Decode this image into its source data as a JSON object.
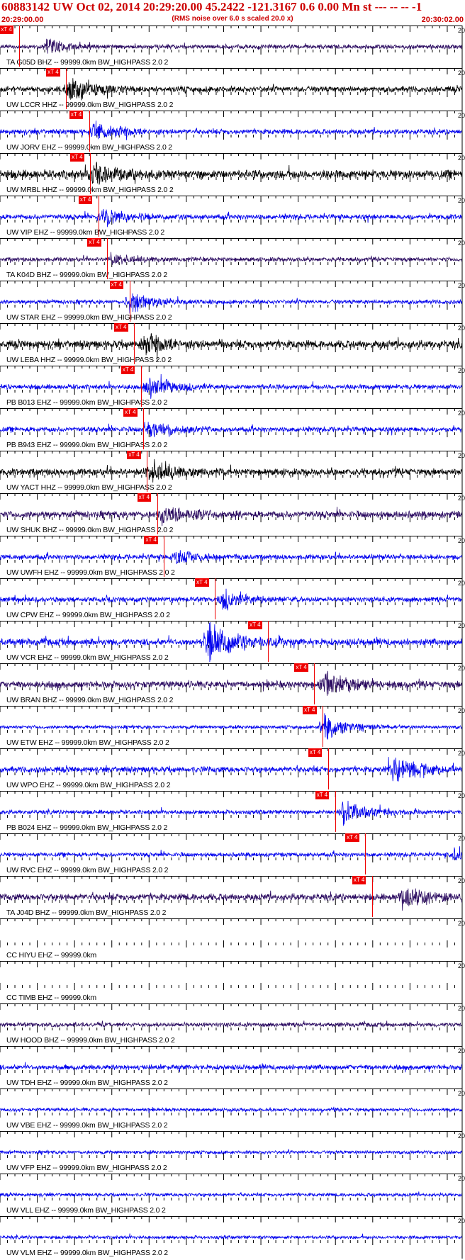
{
  "header": {
    "title": "60883142 UW Oct 02, 2014 20:29:20.00   45.2422 -121.3167  0.6 0.00 Mn st --- -- --  -1",
    "subtitle": "(RMS noise over 6.0 s scaled 20.0 x)",
    "time_start": "20:29:00.00",
    "time_end": "20:30:02.00"
  },
  "colors": {
    "blue_trace": "#0000ee",
    "black_trace": "#000000",
    "purple_trace": "#2a0a60",
    "pick": "#ee0000",
    "header_text": "#cc0000"
  },
  "pick_label": "xT 4",
  "edge_label": "20",
  "stations": [
    {
      "label": "TA G05D BHZ -- 99999.0km BW_HIGHPASS  2.0  2",
      "color": "purple_trace",
      "pick": 0.042,
      "amp": 0.5,
      "burst": 0.1,
      "burstAmp": 1.6
    },
    {
      "label": "UW LCCR HHZ -- 99999.0km BW_HIGHPASS  2.0  2",
      "color": "black_trace",
      "pick": 0.143,
      "amp": 0.7,
      "burst": 0.15,
      "burstAmp": 2.8
    },
    {
      "label": "UW JORV EHZ -- 99999.0km BW_HIGHPASS  2.0  2",
      "color": "blue_trace",
      "pick": 0.193,
      "amp": 0.6,
      "burst": 0.2,
      "burstAmp": 2.2
    },
    {
      "label": "UW MRBL HHZ -- 99999.0km BW_HIGHPASS  2.0  2",
      "color": "black_trace",
      "pick": 0.195,
      "amp": 1.0,
      "burst": 0.2,
      "burstAmp": 2.2
    },
    {
      "label": "UW VIP EHZ -- 99999.0km BW_HIGHPASS  2.0  2",
      "color": "blue_trace",
      "pick": 0.213,
      "amp": 0.6,
      "burst": 0.22,
      "burstAmp": 2.0
    },
    {
      "label": "TA K04D BHZ -- 99999.0km BW_HIGHPASS  2.0  2",
      "color": "purple_trace",
      "pick": 0.232,
      "amp": 0.5,
      "burst": 0.24,
      "burstAmp": 1.2
    },
    {
      "label": "UW STAR EHZ -- 99999.0km BW_HIGHPASS  2.0  2",
      "color": "blue_trace",
      "pick": 0.28,
      "amp": 0.5,
      "burst": 0.28,
      "burstAmp": 2.6
    },
    {
      "label": "UW LEBA HHZ -- 99999.0km BW_HIGHPASS  2.0  2",
      "color": "black_trace",
      "pick": 0.29,
      "amp": 0.9,
      "burst": 0.31,
      "burstAmp": 2.0
    },
    {
      "label": "PB B013 EHZ -- 99999.0km BW_HIGHPASS  2.0  2",
      "color": "blue_trace",
      "pick": 0.305,
      "amp": 0.6,
      "burst": 0.32,
      "burstAmp": 2.4
    },
    {
      "label": "PB B943 EHZ -- 99999.0km BW_HIGHPASS  2.0  2",
      "color": "blue_trace",
      "pick": 0.31,
      "amp": 0.6,
      "burst": 0.32,
      "burstAmp": 1.8
    },
    {
      "label": "UW YACT HHZ -- 99999.0km BW_HIGHPASS  2.0  2",
      "color": "black_trace",
      "pick": 0.318,
      "amp": 0.8,
      "burst": 0.325,
      "burstAmp": 2.6
    },
    {
      "label": "UW SHUK BHZ -- 99999.0km BW_HIGHPASS  2.0  2",
      "color": "purple_trace",
      "pick": 0.34,
      "amp": 0.8,
      "burst": 0.35,
      "burstAmp": 2.0
    },
    {
      "label": "UW UWFH EHZ -- 99999.0km BW_HIGHPASS  2.0  2",
      "color": "blue_trace",
      "pick": 0.355,
      "amp": 0.6,
      "burst": 0.38,
      "burstAmp": 1.6
    },
    {
      "label": "UW CPW EHZ -- 99999.0km BW_HIGHPASS  2.0  2",
      "color": "blue_trace",
      "pick": 0.465,
      "amp": 0.6,
      "burst": 0.48,
      "burstAmp": 2.2
    },
    {
      "label": "UW VCR EHZ -- 99999.0km BW_HIGHPASS  2.0  2",
      "color": "blue_trace",
      "pick": 0.58,
      "amp": 0.8,
      "burst": 0.45,
      "burstAmp": 5.5
    },
    {
      "label": "UW BRAN BHZ -- 99999.0km BW_HIGHPASS  2.0  2",
      "color": "purple_trace",
      "pick": 0.68,
      "amp": 0.8,
      "burst": 0.7,
      "burstAmp": 2.6
    },
    {
      "label": "UW ETW EHZ -- 99999.0km BW_HIGHPASS  2.0  2",
      "color": "blue_trace",
      "pick": 0.698,
      "amp": 0.4,
      "burst": 0.7,
      "burstAmp": 3.2
    },
    {
      "label": "UW WPO EHZ -- 99999.0km BW_HIGHPASS  2.0  2",
      "color": "blue_trace",
      "pick": 0.71,
      "amp": 0.7,
      "burst": 0.85,
      "burstAmp": 3.5
    },
    {
      "label": "PB B024 EHZ -- 99999.0km BW_HIGHPASS  2.0  2",
      "color": "blue_trace",
      "pick": 0.725,
      "amp": 0.5,
      "burst": 0.74,
      "burstAmp": 2.8
    },
    {
      "label": "UW RVC EHZ -- 99999.0km BW_HIGHPASS  2.0  2",
      "color": "blue_trace",
      "pick": 0.79,
      "amp": 0.5,
      "burst": 0.98,
      "burstAmp": 1.8
    },
    {
      "label": "TA J04D BHZ -- 99999.0km BW_HIGHPASS  2.0  2",
      "color": "purple_trace",
      "pick": 0.805,
      "amp": 0.8,
      "burst": 0.87,
      "burstAmp": 2.6
    },
    {
      "label": "CC HIYU EHZ -- 99999.0km",
      "color": "blue_trace",
      "pick": null,
      "amp": 0,
      "burst": null,
      "burstAmp": 0
    },
    {
      "label": "CC TIMB EHZ -- 99999.0km",
      "color": "blue_trace",
      "pick": null,
      "amp": 0,
      "burst": null,
      "burstAmp": 0
    },
    {
      "label": "UW HOOD BHZ -- 99999.0km BW_HIGHPASS  2.0  2",
      "color": "purple_trace",
      "pick": null,
      "amp": 0.5,
      "burst": null,
      "burstAmp": 0
    },
    {
      "label": "UW TDH EHZ -- 99999.0km BW_HIGHPASS  2.0  2",
      "color": "blue_trace",
      "pick": null,
      "amp": 0.6,
      "burst": null,
      "burstAmp": 0
    },
    {
      "label": "UW VBE EHZ -- 99999.0km BW_HIGHPASS  2.0  2",
      "color": "blue_trace",
      "pick": null,
      "amp": 0.4,
      "burst": null,
      "burstAmp": 0
    },
    {
      "label": "UW VFP EHZ -- 99999.0km BW_HIGHPASS  2.0  2",
      "color": "blue_trace",
      "pick": null,
      "amp": 0.4,
      "burst": null,
      "burstAmp": 0
    },
    {
      "label": "UW VLL EHZ -- 99999.0km BW_HIGHPASS  2.0  2",
      "color": "blue_trace",
      "pick": null,
      "amp": 0.4,
      "burst": null,
      "burstAmp": 0
    },
    {
      "label": "UW VLM EHZ -- 99999.0km BW_HIGHPASS  2.0  2",
      "color": "blue_trace",
      "pick": null,
      "amp": 0.4,
      "burst": null,
      "burstAmp": 0
    }
  ]
}
